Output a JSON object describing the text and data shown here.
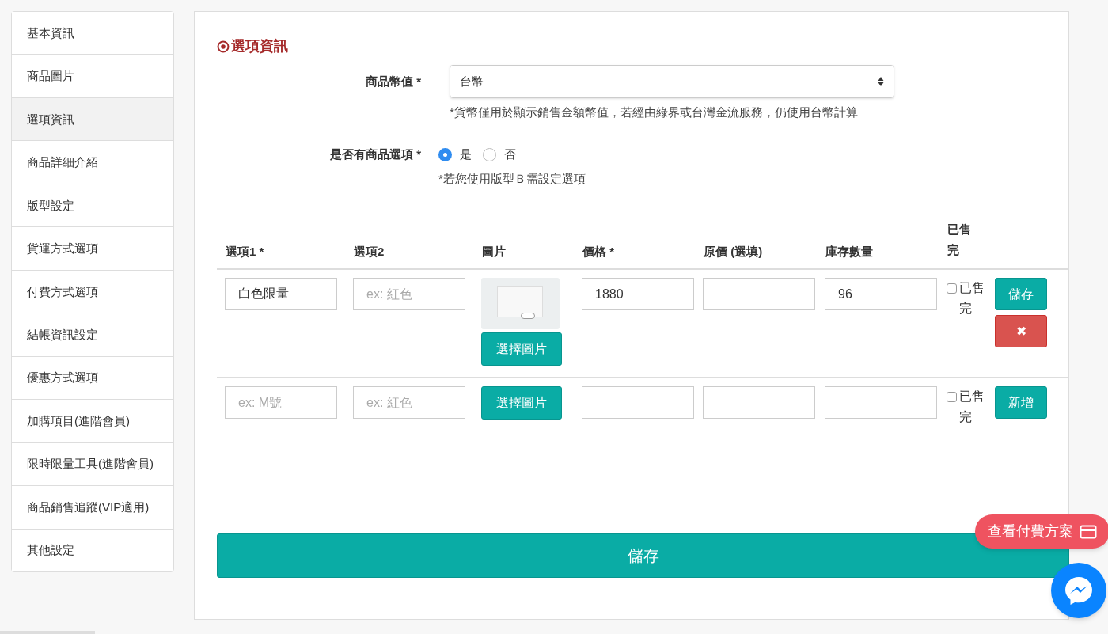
{
  "sidebar": {
    "items": [
      {
        "label": "基本資訊",
        "selected": false
      },
      {
        "label": "商品圖片",
        "selected": false
      },
      {
        "label": "選項資訊",
        "selected": true
      },
      {
        "label": "商品詳細介紹",
        "selected": false
      },
      {
        "label": "版型設定",
        "selected": false
      },
      {
        "label": "貨運方式選項",
        "selected": false
      },
      {
        "label": "付費方式選項",
        "selected": false
      },
      {
        "label": "結帳資訊設定",
        "selected": false
      },
      {
        "label": "優惠方式選項",
        "selected": false
      },
      {
        "label": "加購項目(進階會員)",
        "selected": false
      },
      {
        "label": "限時限量工具(進階會員)",
        "selected": false
      },
      {
        "label": "商品銷售追蹤(VIP適用)",
        "selected": false
      },
      {
        "label": "其他設定",
        "selected": false
      }
    ]
  },
  "section_title": "選項資訊",
  "currency": {
    "label": "商品幣值 *",
    "value": "台幣",
    "note": "*貨幣僅用於顯示銷售金額幣值，若經由綠界或台灣金流服務，仍使用台幣計算"
  },
  "has_options": {
    "label": "是否有商品選項 *",
    "options": [
      {
        "label": "是",
        "selected": true
      },
      {
        "label": "否",
        "selected": false
      }
    ],
    "note": "*若您使用版型Ｂ需設定選項"
  },
  "table": {
    "columns": [
      "選項1 *",
      "選項2",
      "圖片",
      "價格 *",
      "原價 (選填)",
      "庫存數量",
      "已售完"
    ],
    "rows": [
      {
        "option1": {
          "value": "白色限量"
        },
        "option2": {
          "placeholder": "ex: 紅色"
        },
        "image": {
          "has_photo": true,
          "button": "選擇圖片"
        },
        "price": {
          "value": "1880"
        },
        "original_price": {},
        "stock": {
          "value": "96"
        },
        "sold_out": {
          "checked": false,
          "label": "已售完"
        },
        "actions": [
          {
            "kind": "save",
            "label": "儲存"
          },
          {
            "kind": "delete",
            "label": "✖"
          }
        ]
      },
      {
        "option1": {
          "placeholder": "ex: M號"
        },
        "option2": {
          "placeholder": "ex: 紅色"
        },
        "image": {
          "has_photo": false,
          "button": "選擇圖片"
        },
        "price": {},
        "original_price": {},
        "stock": {},
        "sold_out": {
          "checked": false,
          "label": "已售完"
        },
        "actions": [
          {
            "kind": "add",
            "label": "新增"
          }
        ]
      }
    ]
  },
  "save_button": "儲存",
  "pricing_button": "查看付費方案"
}
